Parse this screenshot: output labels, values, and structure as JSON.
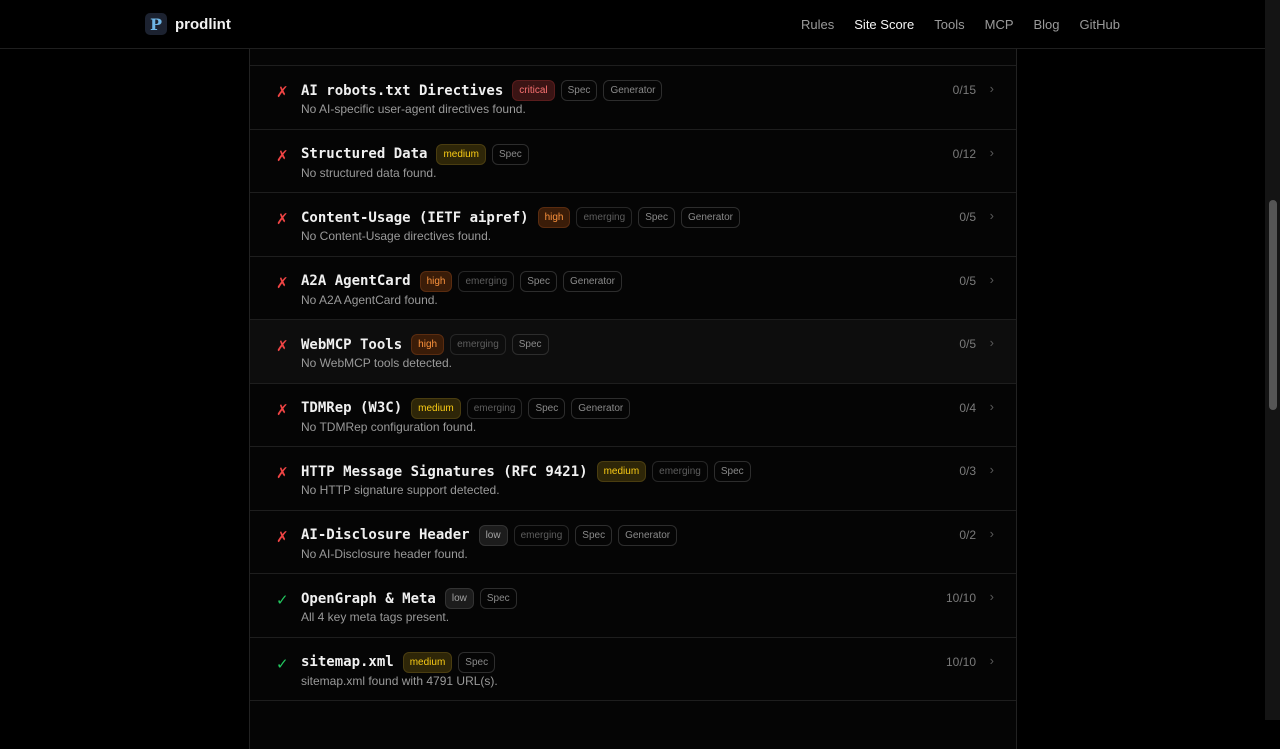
{
  "header": {
    "brand": "prodlint",
    "logo_letter": "P",
    "nav": [
      "Rules",
      "Site Score",
      "Tools",
      "MCP",
      "Blog",
      "GitHub"
    ],
    "active_nav": "Site Score"
  },
  "checks": [
    {
      "status": "fail",
      "title": "AI robots.txt Directives",
      "severity": "critical",
      "emerging": false,
      "spec": "Spec",
      "generator": "Generator",
      "desc": "No AI-specific user-agent directives found.",
      "score": "0/15"
    },
    {
      "status": "fail",
      "title": "Structured Data",
      "severity": "medium",
      "emerging": false,
      "spec": "Spec",
      "generator": "",
      "desc": "No structured data found.",
      "score": "0/12"
    },
    {
      "status": "fail",
      "title": "Content-Usage (IETF aipref)",
      "severity": "high",
      "emerging": true,
      "spec": "Spec",
      "generator": "Generator",
      "desc": "No Content-Usage directives found.",
      "score": "0/5"
    },
    {
      "status": "fail",
      "title": "A2A AgentCard",
      "severity": "high",
      "emerging": true,
      "spec": "Spec",
      "generator": "Generator",
      "desc": "No A2A AgentCard found.",
      "score": "0/5"
    },
    {
      "status": "fail",
      "title": "WebMCP Tools",
      "severity": "high",
      "emerging": true,
      "spec": "Spec",
      "generator": "",
      "desc": "No WebMCP tools detected.",
      "score": "0/5"
    },
    {
      "status": "fail",
      "title": "TDMRep (W3C)",
      "severity": "medium",
      "emerging": true,
      "spec": "Spec",
      "generator": "Generator",
      "desc": "No TDMRep configuration found.",
      "score": "0/4"
    },
    {
      "status": "fail",
      "title": "HTTP Message Signatures (RFC 9421)",
      "severity": "medium",
      "emerging": true,
      "spec": "Spec",
      "generator": "",
      "desc": "No HTTP signature support detected.",
      "score": "0/3"
    },
    {
      "status": "fail",
      "title": "AI-Disclosure Header",
      "severity": "low",
      "emerging": true,
      "spec": "Spec",
      "generator": "Generator",
      "desc": "No AI-Disclosure header found.",
      "score": "0/2"
    },
    {
      "status": "pass",
      "title": "OpenGraph & Meta",
      "severity": "low",
      "emerging": false,
      "spec": "Spec",
      "generator": "",
      "desc": "All 4 key meta tags present.",
      "score": "10/10"
    },
    {
      "status": "pass",
      "title": "sitemap.xml",
      "severity": "medium",
      "emerging": false,
      "spec": "Spec",
      "generator": "",
      "desc": "sitemap.xml found with 4791 URL(s).",
      "score": "10/10"
    }
  ],
  "labels": {
    "emerging": "emerging",
    "fail_icon": "✗",
    "pass_icon": "✓",
    "chevron": "›"
  },
  "colors": {
    "fail": "#ef4444",
    "pass": "#22c55e",
    "critical": "#f87171",
    "high": "#fb923c",
    "medium": "#facc15"
  }
}
